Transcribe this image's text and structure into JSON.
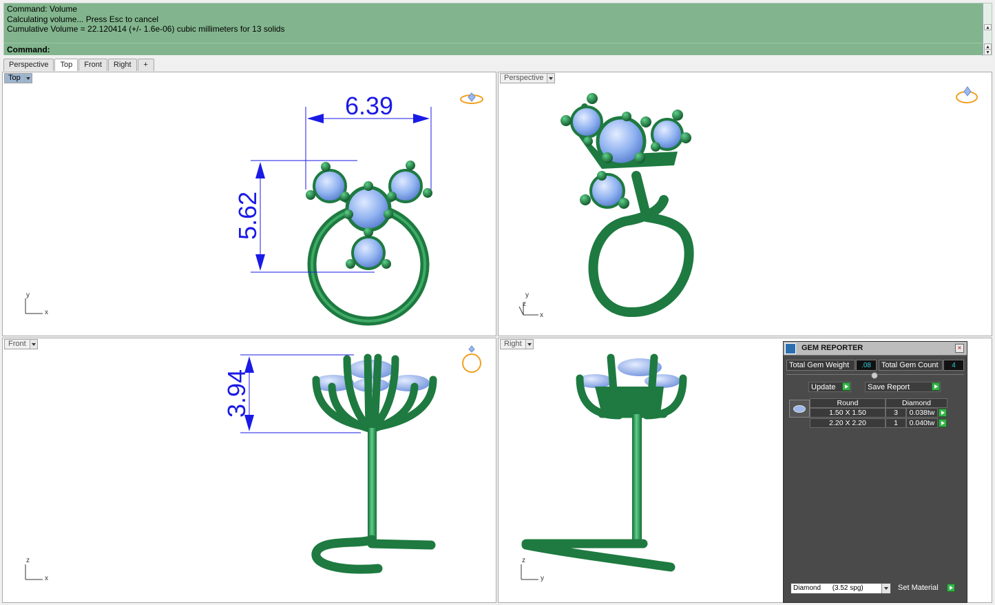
{
  "command": {
    "history": [
      "Command: Volume",
      "Calculating volume... Press Esc to cancel",
      "Cumulative Volume = 22.120414 (+/- 1.6e-06) cubic millimeters for 13 solids"
    ],
    "prompt_label": "Command:"
  },
  "tabs": [
    {
      "label": "Perspective"
    },
    {
      "label": "Top"
    },
    {
      "label": "Front"
    },
    {
      "label": "Right"
    },
    {
      "label": "+"
    }
  ],
  "viewports": {
    "top": {
      "label": "Top",
      "dim_width": "6.39",
      "dim_height": "5.62",
      "axis_v": "y",
      "axis_h": "x"
    },
    "perspective": {
      "label": "Perspective",
      "axis_v": "y",
      "axis_z": "z",
      "axis_h": "x"
    },
    "front": {
      "label": "Front",
      "dim_height": "3.94",
      "axis_v": "z",
      "axis_h": "x"
    },
    "right": {
      "label": "Right",
      "axis_v": "z",
      "axis_h": "y"
    }
  },
  "gem_reporter": {
    "title": "GEM REPORTER",
    "close": "×",
    "total_weight_label": "Total Gem Weight",
    "total_weight_value": ".08",
    "total_count_label": "Total Gem Count",
    "total_count_value": "4",
    "update_label": "Update",
    "save_report_label": "Save Report",
    "col_shape": "Round",
    "col_material": "Diamond",
    "rows": [
      {
        "size": "1.50 X 1.50",
        "count": "3",
        "weight": "0.038tw"
      },
      {
        "size": "2.20 X 2.20",
        "count": "1",
        "weight": "0.040tw"
      }
    ],
    "material_select": "Diamond      (3.52 spg)",
    "set_material_label": "Set Material"
  },
  "colors": {
    "command_bg": "#82b58d",
    "model_green": "#238a4a",
    "gem_blue": "#8fb2f0",
    "dimension_blue": "#1a1ae6"
  }
}
